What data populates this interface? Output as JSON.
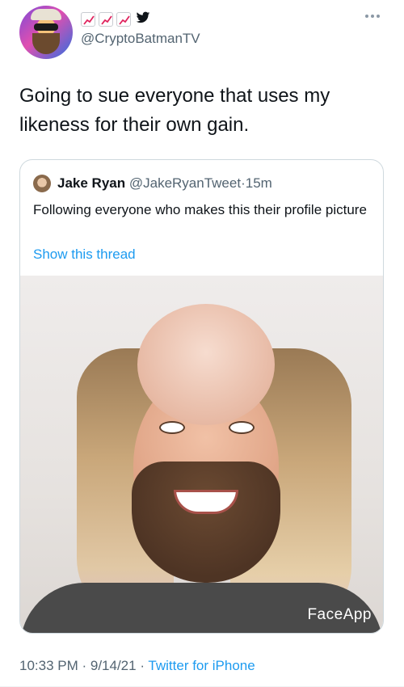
{
  "author": {
    "handle": "@CryptoBatmanTV",
    "name_badges": [
      "chart-increasing-emoji",
      "chart-increasing-emoji",
      "chart-increasing-emoji",
      "twitter-bird-icon"
    ]
  },
  "tweet": {
    "text": "Going to sue everyone that uses my likeness for their own gain."
  },
  "quoted_tweet": {
    "name": "Jake Ryan",
    "handle": "@JakeRyanTweet",
    "separator": "·",
    "time": "15m",
    "text": "Following everyone who makes this their profile picture",
    "show_thread_label": "Show this thread",
    "image_watermark": "FaceApp"
  },
  "meta": {
    "time": "10:33 PM",
    "sep1": " · ",
    "date": "9/14/21",
    "sep2": " · ",
    "source": "Twitter for iPhone"
  },
  "colors": {
    "link": "#1d9bf0",
    "secondary_text": "#536471",
    "border": "#cfd9de"
  }
}
